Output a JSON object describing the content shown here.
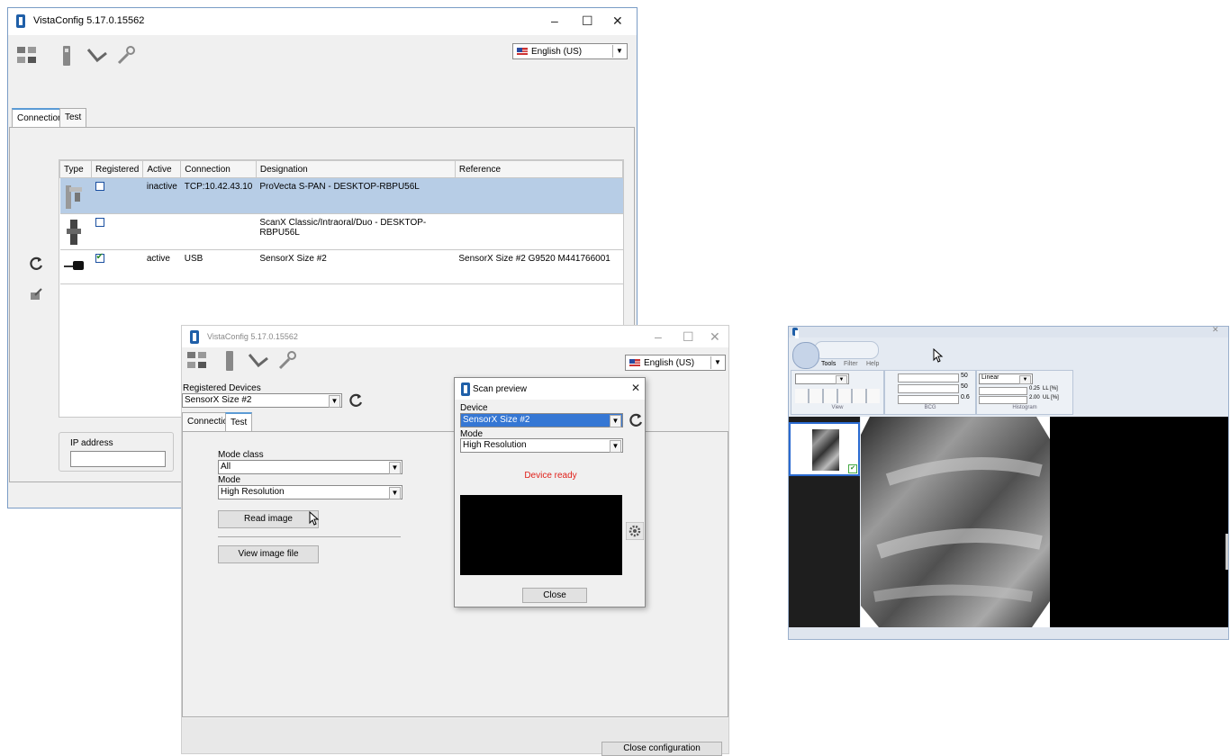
{
  "main_window": {
    "title": "VistaConfig 5.17.0.15562",
    "language": "English (US)",
    "tabs": [
      "Connection",
      "Test"
    ],
    "table": {
      "headers": [
        "Type",
        "Registered",
        "Active",
        "Connection",
        "Designation",
        "Reference"
      ],
      "rows": [
        {
          "registered": false,
          "active": "inactive",
          "connection": "TCP:10.42.43.10",
          "designation": "ProVecta S-PAN - DESKTOP-RBPU56L",
          "reference": ""
        },
        {
          "registered": false,
          "active": "",
          "connection": "",
          "designation": "ScanX Classic/Intraoral/Duo - DESKTOP-RBPU56L",
          "reference": ""
        },
        {
          "registered": true,
          "active": "active",
          "connection": "USB",
          "designation": "SensorX Size #2",
          "reference": "SensorX Size #2 G9520 M441766001"
        }
      ]
    },
    "ip_label": "IP address"
  },
  "second_window": {
    "title": "VistaConfig 5.17.0.15562",
    "language": "English (US)",
    "registered_devices_label": "Registered Devices",
    "registered_device_value": "SensorX Size #2",
    "tabs": [
      "Connection",
      "Test"
    ],
    "mode_class_label": "Mode class",
    "mode_class_value": "All",
    "mode_label": "Mode",
    "mode_value": "High Resolution",
    "read_image": "Read image",
    "view_image_file": "View image file",
    "close_configuration": "Close configuration"
  },
  "scan_preview": {
    "title": "Scan preview",
    "device_label": "Device",
    "device_value": "SensorX Size #2",
    "mode_label": "Mode",
    "mode_value": "High Resolution",
    "status": "Device ready",
    "status_color": "#e0201a",
    "close": "Close"
  },
  "viewer": {
    "menu": [
      "Tools",
      "Filter",
      "Help"
    ],
    "groups": [
      "View",
      "BCG",
      "Histogram"
    ],
    "bcg_values": [
      "50",
      "50",
      "0.6"
    ],
    "histogram_mode": "Linear",
    "ll": "0.25  LL [%]",
    "ul": "2.00  UL [%]"
  }
}
